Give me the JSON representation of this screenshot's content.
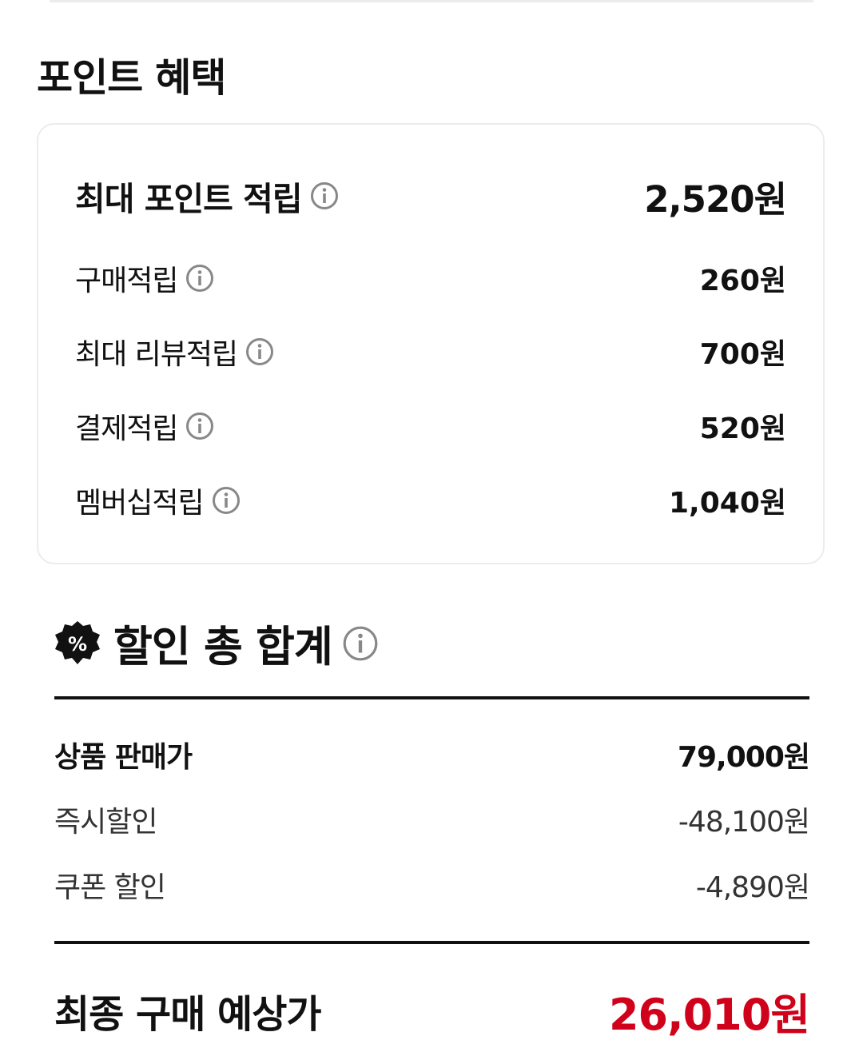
{
  "points": {
    "section_title": "포인트 혜택",
    "max": {
      "label": "최대 포인트 적립",
      "value": "2,520원"
    },
    "items": [
      {
        "label": "구매적립",
        "value": "260원"
      },
      {
        "label": "최대 리뷰적립",
        "value": "700원"
      },
      {
        "label": "결제적립",
        "value": "520원"
      },
      {
        "label": "멤버십적립",
        "value": "1,040원"
      }
    ]
  },
  "discount": {
    "badge_symbol": "%",
    "title": "할인 총 합계",
    "rows": [
      {
        "label": "상품 판매가",
        "value": "79,000원"
      },
      {
        "label": "즉시할인",
        "value": "-48,100원"
      },
      {
        "label": "쿠폰 할인",
        "value": "-4,890원"
      }
    ],
    "final": {
      "label": "최종 구매 예상가",
      "value": "26,010원"
    }
  },
  "colors": {
    "accent": "#d0021b",
    "text": "#111111",
    "border": "#ececec"
  }
}
